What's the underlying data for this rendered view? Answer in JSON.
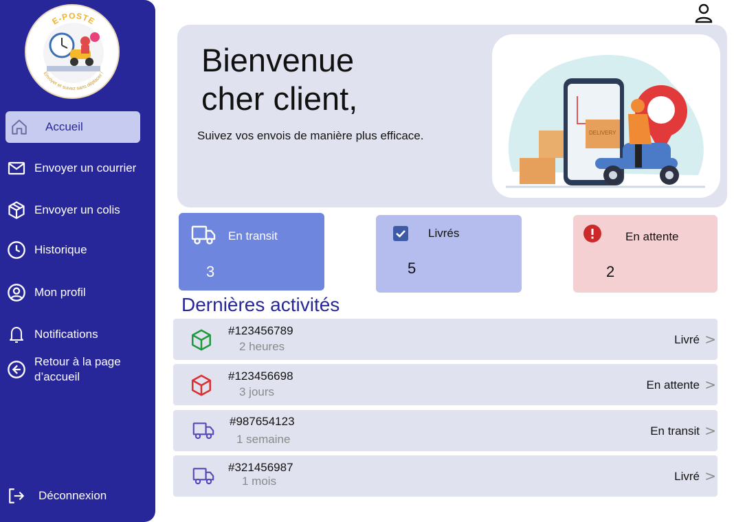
{
  "logo": {
    "text": "E-POSTE",
    "tagline": "Envoyer et suivez sans déplacer !"
  },
  "sidebar": {
    "items": [
      {
        "label": "Accueil",
        "icon": "home-icon"
      },
      {
        "label": "Envoyer un courrier",
        "icon": "mail-icon"
      },
      {
        "label": "Envoyer un colis",
        "icon": "package-icon"
      },
      {
        "label": "Historique",
        "icon": "clock-icon"
      },
      {
        "label": "Mon profil",
        "icon": "user-circle-icon"
      },
      {
        "label": "Notifications",
        "icon": "bell-icon"
      },
      {
        "label": "Retour à la page d’accueil",
        "icon": "back-arrow-icon"
      }
    ],
    "logout": {
      "label": "Déconnexion",
      "icon": "logout-icon"
    }
  },
  "hero": {
    "title_line1": "Bienvenue",
    "title_line2": "cher client,",
    "subtitle": "Suivez vos envois de manière plus efficace.",
    "box_label": "DELIVERY"
  },
  "stats": [
    {
      "label": "En transit",
      "count": "3",
      "icon": "truck-icon",
      "bg": "#6f86de"
    },
    {
      "label": "Livrés",
      "count": "5",
      "icon": "checkbox-icon",
      "bg": "#b4bdee"
    },
    {
      "label": "En attente",
      "count": "2",
      "icon": "alert-icon",
      "bg": "#f5d0d2"
    }
  ],
  "activities": {
    "title": "Dernières activités",
    "rows": [
      {
        "id": "#123456789",
        "time": "2 heures",
        "status": "Livré",
        "icon": "box-green-icon"
      },
      {
        "id": "#123456698",
        "time": "3 jours",
        "status": "En attente",
        "icon": "box-red-icon"
      },
      {
        "id": "#987654123",
        "time": "1 semaine",
        "status": "En transit",
        "icon": "truck-icon"
      },
      {
        "id": "#321456987",
        "time": "1 mois",
        "status": "Livré",
        "icon": "truck-icon"
      }
    ],
    "chevron": ">"
  },
  "colors": {
    "sidebar": "#27279a",
    "accent": "#27279a",
    "panel": "#e1e2ef"
  }
}
